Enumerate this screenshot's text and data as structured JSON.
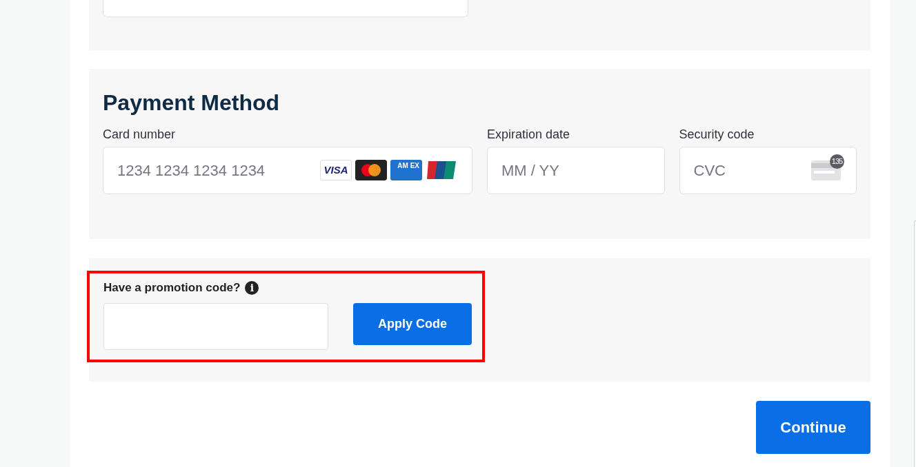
{
  "payment": {
    "title": "Payment Method",
    "fields": [
      {
        "kind": "card",
        "label": "Card number",
        "placeholder": "1234 1234 1234 1234"
      },
      {
        "kind": "plain",
        "label": "Expiration date",
        "placeholder": "MM / YY"
      },
      {
        "kind": "cvc",
        "label": "Security code",
        "placeholder": "CVC"
      }
    ],
    "card_brands": [
      {
        "kind": "visa",
        "text": "VISA"
      },
      {
        "kind": "mastercard"
      },
      {
        "kind": "amex",
        "text": "AM EX"
      },
      {
        "kind": "unionpay"
      }
    ],
    "cvc_badge": "135"
  },
  "promotion": {
    "label": "Have a promotion code?",
    "info_icon": "i",
    "button": "Apply Code",
    "highlighted": true
  },
  "continue_button": "Continue"
}
